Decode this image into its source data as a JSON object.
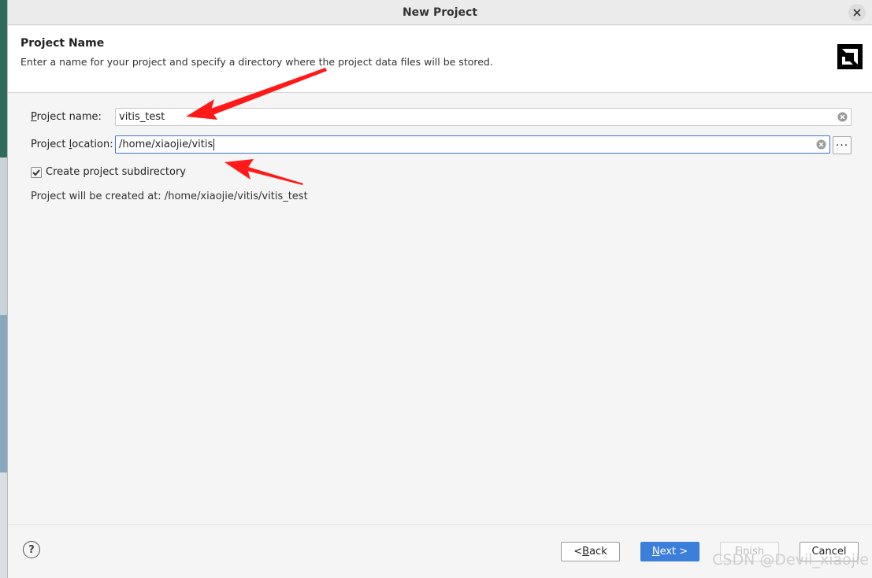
{
  "window": {
    "title": "New Project"
  },
  "header": {
    "title": "Project Name",
    "description": "Enter a name for your project and specify a directory where the project data files will be stored."
  },
  "form": {
    "project_name_label_prefix": "P",
    "project_name_label_rest": "roject name:",
    "project_name_value": "vitis_test",
    "project_location_label_prefix": "Project ",
    "project_location_label_u": "l",
    "project_location_label_rest": "ocation:",
    "project_location_value": "/home/xiaojie/vitis",
    "browse_label": "···",
    "subdirectory_label": "Create project subdirectory",
    "subdirectory_checked": true,
    "created_at_text": "Project will be created at: /home/xiaojie/vitis/vitis_test"
  },
  "footer": {
    "help_label": "?",
    "back_prefix": "< ",
    "back_u": "B",
    "back_rest": "ack",
    "next_u": "N",
    "next_rest": "ext >",
    "finish_label": "Finish",
    "cancel_label": "Cancel"
  },
  "watermark": "CSDN @Devil_xiaojie",
  "colors": {
    "accent": "#3c7fdb",
    "annotation_arrow": "#ff1a1a"
  },
  "icons": [
    "close-icon",
    "amd-logo-icon",
    "clear-icon",
    "checkmark-icon",
    "help-icon"
  ]
}
